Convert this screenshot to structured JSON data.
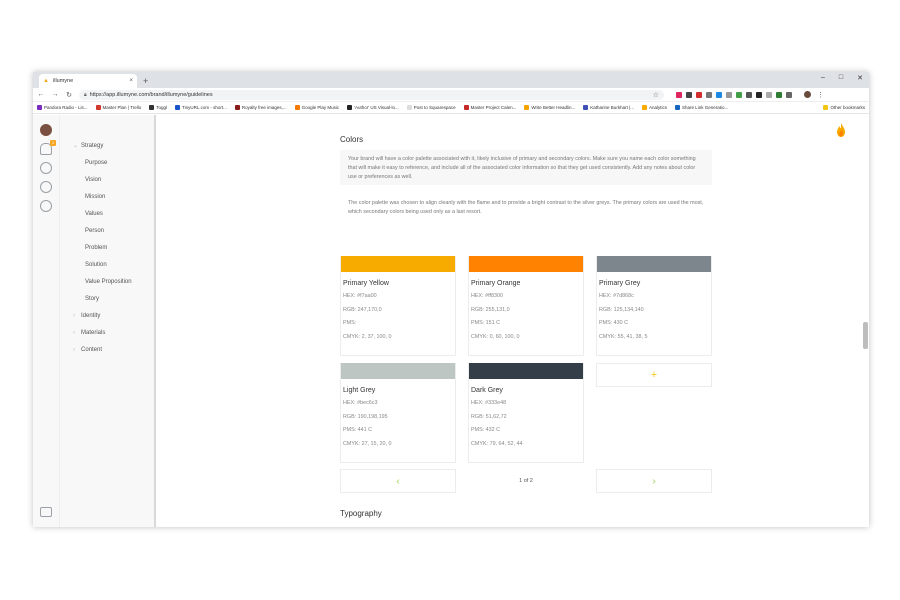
{
  "browser": {
    "tab_title": "illumyne",
    "tab_close": "×",
    "new_tab": "+",
    "url": "https://app.illumyne.com/brand/illumyne/guidelines",
    "bookmarks": [
      {
        "label": "Pandora Radio - Lis...",
        "color": "#7b2cbf"
      },
      {
        "label": "Master Plan | Trello",
        "color": "#d0392b"
      },
      {
        "label": "Toggl",
        "color": "#333333"
      },
      {
        "label": "TinyURL.com - short...",
        "color": "#1a55c8"
      },
      {
        "label": "Royalty free images,...",
        "color": "#8b1a1a"
      },
      {
        "label": "Google Play Music",
        "color": "#f57c00"
      },
      {
        "label": "'Author' US Visual-lo...",
        "color": "#222222"
      },
      {
        "label": "Post to Squarespace",
        "color": "#dddddd"
      },
      {
        "label": "Master Project Calen...",
        "color": "#c62828"
      },
      {
        "label": "Write Better Headlin...",
        "color": "#f4a300"
      },
      {
        "label": "Katharine Burkhart |...",
        "color": "#3f51b5"
      },
      {
        "label": "Analytics",
        "color": "#f9ab00"
      },
      {
        "label": "Share Link Generatio...",
        "color": "#1565c0"
      }
    ],
    "other_bookmarks": "Other bookmarks"
  },
  "rail": {
    "notification_count": "1"
  },
  "sidebar": {
    "sections": [
      {
        "label": "Strategy",
        "expanded": true
      },
      {
        "label": "Identity",
        "expanded": false
      },
      {
        "label": "Materials",
        "expanded": false
      },
      {
        "label": "Content",
        "expanded": false
      }
    ],
    "strategy_items": [
      "Purpose",
      "Vision",
      "Mission",
      "Values",
      "Person",
      "Problem",
      "Solution",
      "Value Proposition",
      "Story"
    ]
  },
  "main": {
    "section_title": "Colors",
    "note": "Your brand will have a color palette associated with it, likely inclusive of primary and secondary colors. Make sure you name each color something that will make it easy to reference, and include all of the associated color information so that they get used consistently. Add any notes about color use or preferences as well.",
    "description": "The color palette was chosen to align cleanly with the flame and to provide a bright contrast to the silver greys. The primary colors are used the most, which secondary colors being used only as a last resort.",
    "colors": [
      {
        "name": "Primary Yellow",
        "swatch": "#f7aa00",
        "hex": "HEX: #f7aa00",
        "rgb": "RGB: 247,170,0",
        "pms": "PMS:",
        "cmyk": "CMYK: 2, 37, 100, 0"
      },
      {
        "name": "Primary Orange",
        "swatch": "#ff8300",
        "hex": "HEX: #ff8300",
        "rgb": "RGB: 255,131,0",
        "pms": "PMS: 151 C",
        "cmyk": "CMYK: 0, 60, 100, 0"
      },
      {
        "name": "Primary Grey",
        "swatch": "#7d868c",
        "hex": "HEX: #7d868c",
        "rgb": "RGB: 125,134,140",
        "pms": "PMS: 430 C",
        "cmyk": "CMYK: 55, 41, 38, 5"
      },
      {
        "name": "Light Grey",
        "swatch": "#bec6c3",
        "hex": "HEX: #bec6c3",
        "rgb": "RGB: 190,198,195",
        "pms": "PMS: 441 C",
        "cmyk": "CMYK: 27, 15, 20, 0"
      },
      {
        "name": "Dark Grey",
        "swatch": "#333e48",
        "hex": "HEX: #333e48",
        "rgb": "RGB: 51,62,72",
        "pms": "PMS: 432 C",
        "cmyk": "CMYK: 79, 64, 52, 44"
      }
    ],
    "add_label": "+",
    "pager": {
      "prev": "‹",
      "info": "1 of 2",
      "next": "›"
    },
    "next_section_title": "Typography"
  },
  "theme": {
    "accent": "#f5c518",
    "pager_arrow": "#9bd45a",
    "flame": "#f7aa00"
  }
}
